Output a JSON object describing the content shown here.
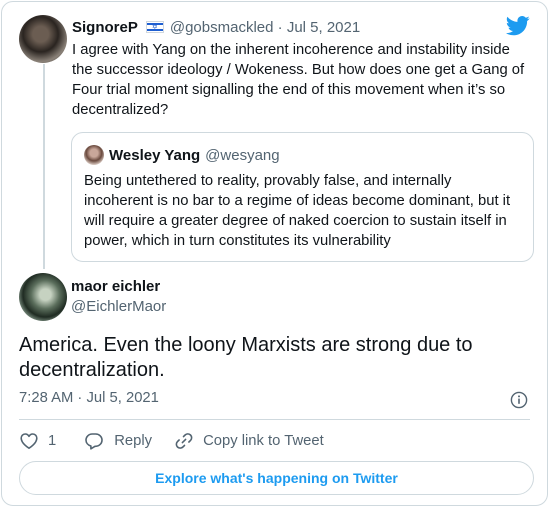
{
  "brand": {
    "accent": "#1d9bf0",
    "muted": "#536471",
    "border": "#cfd9de"
  },
  "parent_tweet": {
    "name": "SignoreP",
    "flag_icon": "israel-flag-icon",
    "handle": "@gobsmackled",
    "separator": "·",
    "date": "Jul 5, 2021",
    "text": "I agree with Yang on the inherent incoherence and instability inside the successor ideology / Wokeness. But how does one get a Gang of Four trial moment signalling the end of this movement when it’s so decentralized?"
  },
  "quoted_tweet": {
    "name": "Wesley Yang",
    "handle": "@wesyang",
    "text": "Being untethered to reality, provably false, and internally incoherent is no bar to a regime of ideas become dominant, but it will require a greater degree of naked coercion to sustain itself in power, which in turn constitutes its vulnerability"
  },
  "main_tweet": {
    "name": "maor eichler",
    "handle": "@EichlerMaor",
    "text": "America. Even the loony Marxists are strong due to decentralization.",
    "time": "7:28 AM",
    "separator": "·",
    "date": "Jul 5, 2021"
  },
  "actions": {
    "like_count": "1",
    "reply_label": "Reply",
    "copy_link_label": "Copy link to Tweet"
  },
  "explore_label": "Explore what's happening on Twitter"
}
